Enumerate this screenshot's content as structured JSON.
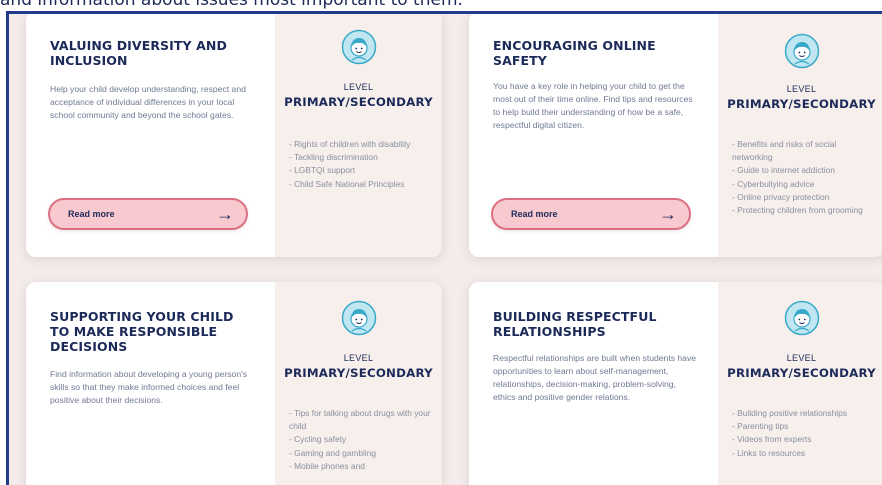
{
  "page": {
    "intro_fragment": "and information about issues most important to them."
  },
  "cards": [
    {
      "title": "VALUING DIVERSITY AND INCLUSION",
      "description": "Help your child develop understanding, respect and acceptance of individual differences in your local school community and beyond the school gates.",
      "read_more": "Read more",
      "level_label": "LEVEL",
      "level_value": "PRIMARY/SECONDARY",
      "topics": [
        "- Rights of children with disability",
        "- Tackling discrimination",
        "- LGBTQI support",
        "- Child Safe National Principles"
      ]
    },
    {
      "title": "ENCOURAGING ONLINE SAFETY",
      "description": "You have a key role in helping your child to get the most out of their time online. Find tips and resources to help build their understanding of how be a safe, respectful digital citizen.",
      "read_more": "Read more",
      "level_label": "LEVEL",
      "level_value": "PRIMARY/SECONDARY",
      "topics": [
        "- Benefits and risks of social networking",
        "- Guide to internet addiction",
        "- Cyberbullying advice",
        "- Online privacy protection",
        "- Protecting children from grooming"
      ]
    },
    {
      "title": "SUPPORTING YOUR CHILD TO MAKE RESPONSIBLE DECISIONS",
      "description": "Find information about developing a young person's skills so that they make informed choices and feel positive about their decisions.",
      "level_label": "LEVEL",
      "level_value": "PRIMARY/SECONDARY",
      "topics": [
        "- Tips for talking about drugs with your child",
        "- Cycling safety",
        "- Gaming and gambling",
        "- Mobile phones and"
      ]
    },
    {
      "title": "BUILDING RESPECTFUL RELATIONSHIPS",
      "description": "Respectful relationships are built when students have opportunities to learn about self-management, relationships, decision-making, problem-solving, ethics and positive gender relations.",
      "level_label": "LEVEL",
      "level_value": "PRIMARY/SECONDARY",
      "topics": [
        "- Building positive relationships",
        "- Parenting tips",
        "- Videos from experts",
        "- Links to resources"
      ]
    }
  ],
  "colors": {
    "frame_border": "#243a8a",
    "page_bg": "#f3ecea",
    "title_navy": "#1c2a59",
    "button_fill": "#f8c9cf",
    "button_border": "#dd6f82",
    "avatar_teal": "#39a9c9"
  },
  "icons": {
    "avatar": "child-face-icon",
    "arrow": "arrow-right-icon"
  }
}
